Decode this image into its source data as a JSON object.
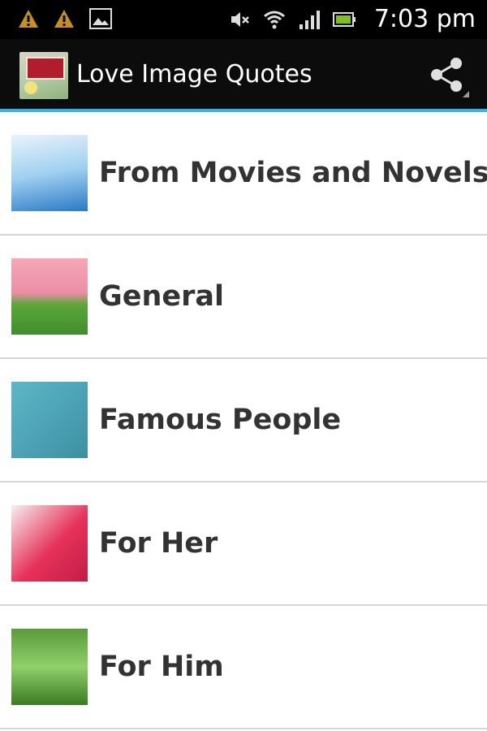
{
  "status_bar": {
    "left_icons": [
      "warning-icon",
      "warning-icon",
      "image-icon"
    ],
    "right_icons": [
      "mute-icon",
      "wifi-icon",
      "signal-icon",
      "battery-icon"
    ],
    "time": "7:03 pm"
  },
  "action_bar": {
    "title": "Love Image Quotes",
    "share_icon": "share-icon",
    "accent_color": "#33b5e5"
  },
  "categories": [
    {
      "label": "From Movies and Novels",
      "thumb_icon": "movies-novels-thumbnail"
    },
    {
      "label": "General",
      "thumb_icon": "general-thumbnail"
    },
    {
      "label": "Famous People",
      "thumb_icon": "famous-people-thumbnail"
    },
    {
      "label": "For Her",
      "thumb_icon": "for-her-thumbnail"
    },
    {
      "label": "For Him",
      "thumb_icon": "for-him-thumbnail"
    }
  ]
}
